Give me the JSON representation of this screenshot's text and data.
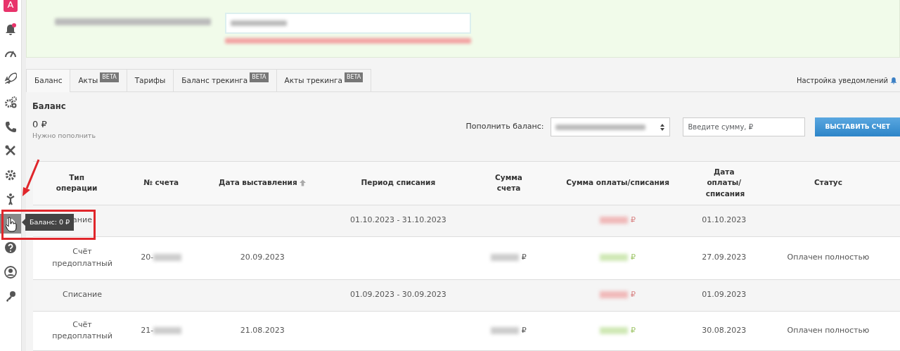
{
  "sidebar": {
    "items": [
      {
        "kind": "logo",
        "label": "A",
        "selected": false
      },
      {
        "kind": "bell",
        "selected": false
      },
      {
        "kind": "gauge",
        "selected": false
      },
      {
        "kind": "rocket",
        "selected": false
      },
      {
        "kind": "gears",
        "selected": false
      },
      {
        "kind": "phone",
        "selected": false
      },
      {
        "kind": "tools",
        "selected": false
      },
      {
        "kind": "gear",
        "selected": false
      },
      {
        "kind": "figure",
        "selected": false
      },
      {
        "kind": "document",
        "selected": true
      },
      {
        "kind": "question",
        "selected": false
      },
      {
        "kind": "user",
        "selected": false
      },
      {
        "kind": "key",
        "selected": false
      }
    ]
  },
  "tooltip": {
    "text": "Баланс: 0 ₽"
  },
  "tabs": [
    {
      "label": "Баланс",
      "selected": true
    },
    {
      "label": "Акты",
      "badge": "BETA",
      "selected": false
    },
    {
      "label": "Тарифы",
      "selected": false
    },
    {
      "label": "Баланс трекинга",
      "badge": "BETA",
      "selected": false
    },
    {
      "label": "Акты трекинга",
      "badge": "BETA",
      "selected": false
    }
  ],
  "notification_settings": {
    "label": "Настройка уведомлений"
  },
  "balance": {
    "title": "Баланс",
    "amount": "0 ₽",
    "hint": "Нужно пополнить"
  },
  "top_up": {
    "label": "Пополнить баланс:",
    "placeholder": "Введите сумму, ₽",
    "button": "ВЫСТАВИТЬ СЧЕТ"
  },
  "table": {
    "columns": [
      {
        "label": "Тип операции"
      },
      {
        "label": "№ счета"
      },
      {
        "label": "Дата выставления",
        "sorted": true
      },
      {
        "label": "Период списания"
      },
      {
        "label": "Сумма счета"
      },
      {
        "label": "Сумма оплаты/списания"
      },
      {
        "label": "Дата оплаты/списания"
      },
      {
        "label": "Статус"
      }
    ],
    "rows": [
      {
        "kind": "writeoff",
        "type": "ание",
        "period": "01.10.2023 - 31.10.2023",
        "paid_sum": "₽",
        "paid_date": "01.10.2023"
      },
      {
        "kind": "invoice",
        "type": "Счёт предоплатный",
        "invoice": "20-",
        "issue_date": "20.09.2023",
        "invoice_sum": "₽",
        "paid_sum": "₽",
        "paid_date": "27.09.2023",
        "status": "Оплачен полностью"
      },
      {
        "kind": "writeoff",
        "type": "Списание",
        "period": "01.09.2023 - 30.09.2023",
        "paid_sum": "₽",
        "paid_date": "01.09.2023"
      },
      {
        "kind": "invoice",
        "type": "Счёт предоплатный",
        "invoice": "21-",
        "issue_date": "21.08.2023",
        "invoice_sum": "₽",
        "paid_sum": "₽",
        "paid_date": "30.08.2023",
        "status": "Оплачен полностью"
      }
    ]
  }
}
